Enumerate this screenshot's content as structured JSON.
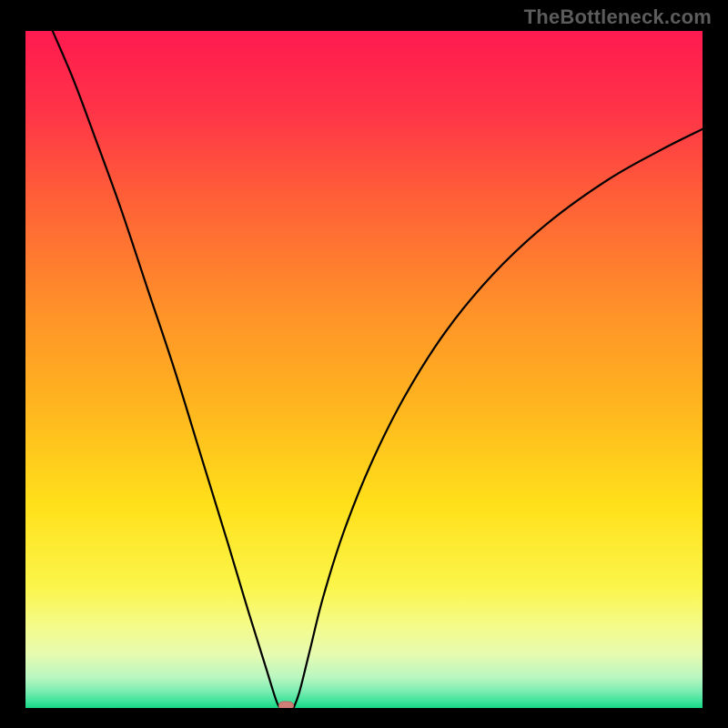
{
  "watermark": "TheBottleneck.com",
  "colors": {
    "frame": "#000000",
    "curve": "#000000",
    "marker_fill": "#cf7f78",
    "marker_stroke": "#b96a63",
    "gradient_stops": [
      {
        "offset": 0.0,
        "color": "#ff1a4f"
      },
      {
        "offset": 0.12,
        "color": "#ff3448"
      },
      {
        "offset": 0.25,
        "color": "#ff6037"
      },
      {
        "offset": 0.4,
        "color": "#ff8e2a"
      },
      {
        "offset": 0.55,
        "color": "#ffb41f"
      },
      {
        "offset": 0.7,
        "color": "#ffe01a"
      },
      {
        "offset": 0.82,
        "color": "#fbf54a"
      },
      {
        "offset": 0.88,
        "color": "#f4fb8a"
      },
      {
        "offset": 0.92,
        "color": "#e7fbb0"
      },
      {
        "offset": 0.955,
        "color": "#b9f6c0"
      },
      {
        "offset": 0.975,
        "color": "#7cedb2"
      },
      {
        "offset": 0.99,
        "color": "#3fe39c"
      },
      {
        "offset": 1.0,
        "color": "#16d784"
      }
    ]
  },
  "chart_data": {
    "type": "line",
    "title": "",
    "xlabel": "",
    "ylabel": "",
    "xlim": [
      0,
      100
    ],
    "ylim": [
      0,
      100
    ],
    "marker": {
      "x": 38.5,
      "y": 0
    },
    "left_branch": {
      "description": "steep left side descending to the minimum",
      "points": [
        {
          "x": 4.0,
          "y": 100.0
        },
        {
          "x": 7.0,
          "y": 93.0
        },
        {
          "x": 10.0,
          "y": 85.0
        },
        {
          "x": 14.0,
          "y": 74.0
        },
        {
          "x": 18.0,
          "y": 62.0
        },
        {
          "x": 22.0,
          "y": 50.0
        },
        {
          "x": 26.0,
          "y": 37.0
        },
        {
          "x": 30.0,
          "y": 24.0
        },
        {
          "x": 33.0,
          "y": 14.0
        },
        {
          "x": 35.5,
          "y": 6.0
        },
        {
          "x": 37.0,
          "y": 1.2
        },
        {
          "x": 37.6,
          "y": 0.0
        }
      ]
    },
    "right_branch": {
      "description": "curving right side rising from the minimum, concave",
      "points": [
        {
          "x": 39.6,
          "y": 0.0
        },
        {
          "x": 40.5,
          "y": 2.5
        },
        {
          "x": 42.0,
          "y": 8.5
        },
        {
          "x": 44.0,
          "y": 16.5
        },
        {
          "x": 47.0,
          "y": 26.0
        },
        {
          "x": 51.0,
          "y": 36.0
        },
        {
          "x": 56.0,
          "y": 46.0
        },
        {
          "x": 62.0,
          "y": 55.5
        },
        {
          "x": 69.0,
          "y": 64.0
        },
        {
          "x": 77.0,
          "y": 71.5
        },
        {
          "x": 86.0,
          "y": 78.0
        },
        {
          "x": 94.0,
          "y": 82.5
        },
        {
          "x": 100.0,
          "y": 85.5
        }
      ]
    }
  }
}
